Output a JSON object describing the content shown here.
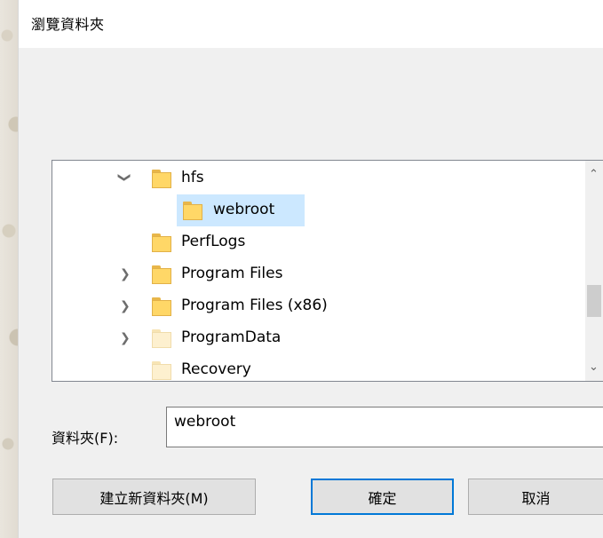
{
  "window": {
    "title": "瀏覽資料夾"
  },
  "tree": {
    "items": [
      {
        "label": "hfs",
        "expander": "expanded",
        "level": 1,
        "selected": false,
        "icon": "folder-icon"
      },
      {
        "label": "webroot",
        "expander": "none",
        "level": 2,
        "selected": true,
        "icon": "folder-icon"
      },
      {
        "label": "PerfLogs",
        "expander": "none",
        "level": 1,
        "selected": false,
        "icon": "folder-icon"
      },
      {
        "label": "Program Files",
        "expander": "collapsed",
        "level": 1,
        "selected": false,
        "icon": "folder-icon"
      },
      {
        "label": "Program Files (x86)",
        "expander": "collapsed",
        "level": 1,
        "selected": false,
        "icon": "folder-icon"
      },
      {
        "label": "ProgramData",
        "expander": "collapsed",
        "level": 1,
        "selected": false,
        "icon": "folder-icon-hidden"
      },
      {
        "label": "Recovery",
        "expander": "none",
        "level": 1,
        "selected": false,
        "icon": "folder-icon-hidden"
      }
    ],
    "scroll_up_icon": "chevron-up-icon",
    "scroll_down_icon": "chevron-down-icon"
  },
  "folder_field": {
    "label": "資料夾(F):",
    "value": "webroot"
  },
  "buttons": {
    "new_folder": "建立新資料夾(M)",
    "ok": "確定",
    "cancel": "取消"
  },
  "colors": {
    "selection": "#cce8ff",
    "primary_border": "#0078d7",
    "folder": "#ffd767"
  }
}
